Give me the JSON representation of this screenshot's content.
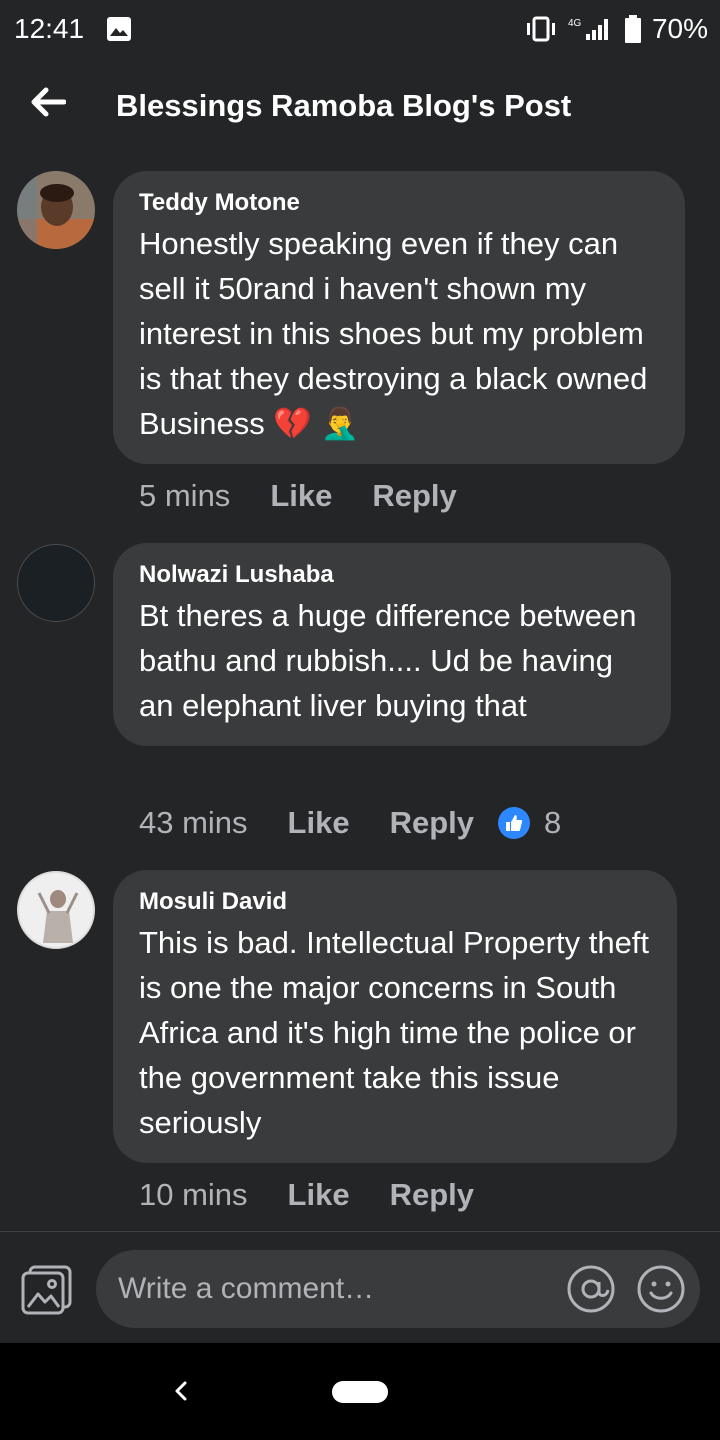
{
  "status_bar": {
    "time": "12:41",
    "network": "4G",
    "battery": "70%"
  },
  "header": {
    "title": "Blessings Ramoba Blog's Post"
  },
  "comments": [
    {
      "author": "Teddy Motone",
      "text": "Honestly speaking even if they can sell it 50rand i haven't shown my interest in this shoes but my problem is that they destroying a black owned Business 💔 🤦‍♂️",
      "time": "5 mins",
      "like_label": "Like",
      "reply_label": "Reply"
    },
    {
      "author": "Nolwazi Lushaba",
      "text": "Bt theres a huge difference between  bathu and rubbish.... Ud be having an elephant liver buying that",
      "time": "43 mins",
      "like_label": "Like",
      "reply_label": "Reply",
      "reaction_count": "8"
    },
    {
      "author": "Mosuli David",
      "text": "This is bad. Intellectual Property theft is one the major concerns in South Africa and it's high time the police or the government take this issue seriously",
      "time": "10 mins",
      "like_label": "Like",
      "reply_label": "Reply"
    }
  ],
  "composer": {
    "placeholder": "Write a comment…"
  },
  "colors": {
    "background": "#242526",
    "bubble": "#3a3b3c",
    "like_blue": "#2d88ff",
    "meta_text": "#b0b3b8"
  },
  "icons": [
    "gallery-icon",
    "vibrate-icon",
    "signal-icon",
    "battery-icon",
    "back-arrow-icon",
    "thumbs-up-icon",
    "photo-icon",
    "at-icon",
    "emoji-icon",
    "nav-back-icon",
    "nav-home-pill"
  ]
}
